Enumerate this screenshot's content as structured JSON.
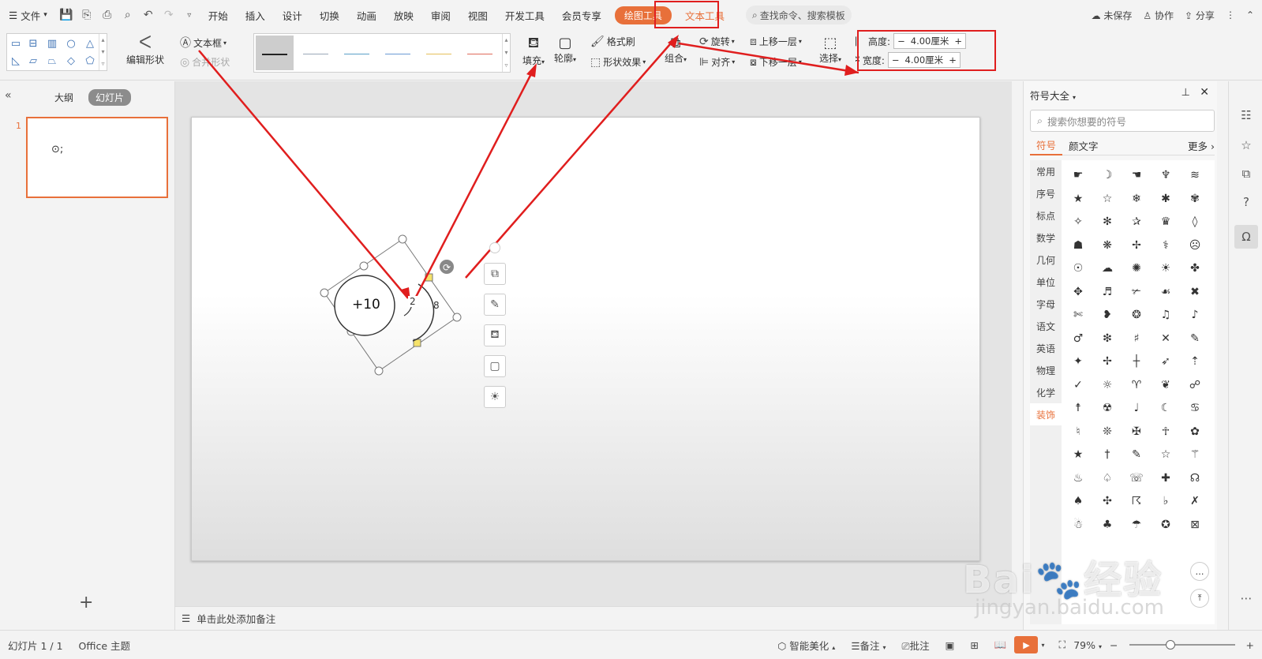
{
  "menubar": {
    "file": "文件",
    "tabs": [
      "开始",
      "插入",
      "设计",
      "切换",
      "动画",
      "放映",
      "审阅",
      "视图",
      "开发工具",
      "会员专享"
    ],
    "draw_tool": "绘图工具",
    "text_tool": "文本工具",
    "search_placeholder": "查找命令、搜索模板",
    "unsaved": "未保存",
    "collab": "协作",
    "share": "分享"
  },
  "ribbon": {
    "edit_shape": "编辑形状",
    "textbox": "文本框",
    "merge_shape": "合并形状",
    "fill": "填充",
    "outline": "轮廓",
    "format_brush": "格式刷",
    "shape_effect": "形状效果",
    "group": "组合",
    "rotate": "旋转",
    "align": "对齐",
    "bring_forward": "上移一层",
    "send_backward": "下移一层",
    "select": "选择",
    "height_label": "高度:",
    "height_value": "4.00厘米",
    "width_label": "宽度:",
    "width_value": "4.00厘米",
    "line_colors": [
      "#222222",
      "#9aa7b8",
      "#5aa0c8",
      "#6b9ad4",
      "#e5c05a",
      "#e06a5a"
    ]
  },
  "left_panel": {
    "outline_tab": "大纲",
    "slides_tab": "幻灯片",
    "slide_number": "1"
  },
  "slide": {
    "big_text": "+10",
    "small_text_1": "2",
    "small_text_2": "8"
  },
  "notes": {
    "placeholder": "单击此处添加备注"
  },
  "symbols_panel": {
    "title": "符号大全",
    "search_placeholder": "搜索你想要的符号",
    "tab_symbols": "符号",
    "tab_emoticons": "颜文字",
    "more": "更多",
    "categories": [
      "常用",
      "序号",
      "标点",
      "数学",
      "几何",
      "单位",
      "字母",
      "语文",
      "英语",
      "物理",
      "化学",
      "装饰"
    ],
    "active_category": "装饰",
    "symbols": [
      "☛",
      "☽",
      "☚",
      "♆",
      "≋",
      "★",
      "☆",
      "❄",
      "✱",
      "✾",
      "✧",
      "✻",
      "✰",
      "♛",
      "◊",
      "☗",
      "❋",
      "✢",
      "⚕",
      "☹",
      "☉",
      "☁",
      "✺",
      "☀",
      "✤",
      "✥",
      "♬",
      "✃",
      "☙",
      "✖",
      "✄",
      "❥",
      "❂",
      "♫",
      "♪",
      "♂",
      "❇",
      "♯",
      "✕",
      "✎",
      "✦",
      "✢",
      "┼",
      "➶",
      "⇡",
      "✓",
      "☼",
      "♈",
      "❦",
      "☍",
      "☨",
      "☢",
      "♩",
      "☾",
      "♋",
      "♮",
      "❊",
      "✠",
      "☥",
      "✿",
      "★",
      "†",
      "✎",
      "☆",
      "⚚",
      "♨",
      "♤",
      "☏",
      "✚",
      "☊",
      "♠",
      "✣",
      "☈",
      "♭",
      "✗",
      "☃",
      "♣",
      "☂",
      "✪",
      "⊠"
    ]
  },
  "statusbar": {
    "slide_info": "幻灯片 1 / 1",
    "theme": "Office 主题",
    "beautify": "智能美化",
    "notes": "备注",
    "comment": "批注",
    "zoom": "79%"
  },
  "watermark": {
    "main": "Bai",
    "main2": "经验",
    "sub": "jingyan.baidu.com"
  }
}
